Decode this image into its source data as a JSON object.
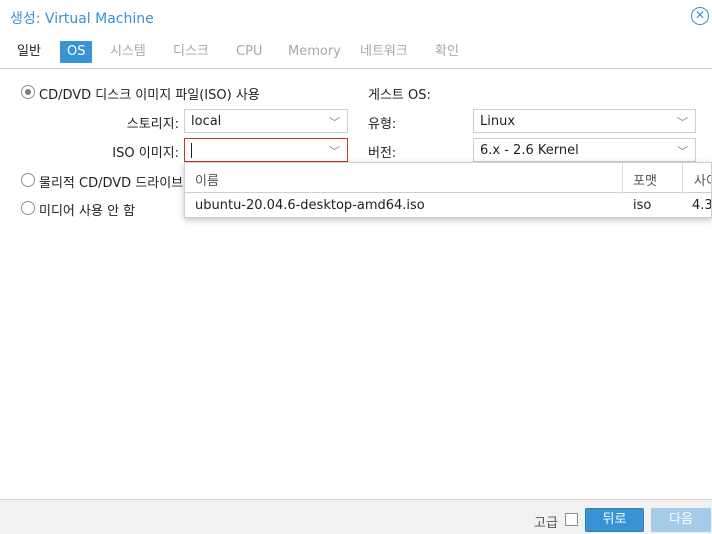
{
  "window": {
    "title": "생성: Virtual Machine",
    "close_icon": "close-circle-icon"
  },
  "tabs": [
    {
      "label": "일반",
      "state": "normal"
    },
    {
      "label": "OS",
      "state": "active"
    },
    {
      "label": "시스템",
      "state": "disabled"
    },
    {
      "label": "디스크",
      "state": "disabled"
    },
    {
      "label": "CPU",
      "state": "disabled"
    },
    {
      "label": "Memory",
      "state": "disabled"
    },
    {
      "label": "네트워크",
      "state": "disabled"
    },
    {
      "label": "확인",
      "state": "disabled"
    }
  ],
  "media": {
    "option_iso": {
      "label": "CD/DVD 디스크 이미지 파일(ISO) 사용",
      "checked": true
    },
    "storage": {
      "label": "스토리지:",
      "value": "local"
    },
    "iso_image": {
      "label": "ISO 이미지:",
      "value": ""
    },
    "option_physical": {
      "label": "물리적 CD/DVD 드라이브",
      "checked": false
    },
    "option_none": {
      "label": "미디어 사용 안 함",
      "checked": false
    }
  },
  "guest_os": {
    "heading": "게스트 OS:",
    "type": {
      "label": "유형:",
      "value": "Linux"
    },
    "version": {
      "label": "버전:",
      "value": "6.x - 2.6 Kernel"
    }
  },
  "iso_dropdown": {
    "columns": [
      "이름",
      "포맷",
      "사이"
    ],
    "rows": [
      {
        "name": "ubuntu-20.04.6-desktop-amd64.iso",
        "format": "iso",
        "size": "4.3"
      }
    ]
  },
  "footer": {
    "advanced_label": "고급",
    "advanced_checked": false,
    "back_label": "뒤로",
    "next_label": "다음"
  },
  "colors": {
    "accent": "#3892d4",
    "focus_border": "#c0392b",
    "disabled_button": "#a4cbe8"
  }
}
